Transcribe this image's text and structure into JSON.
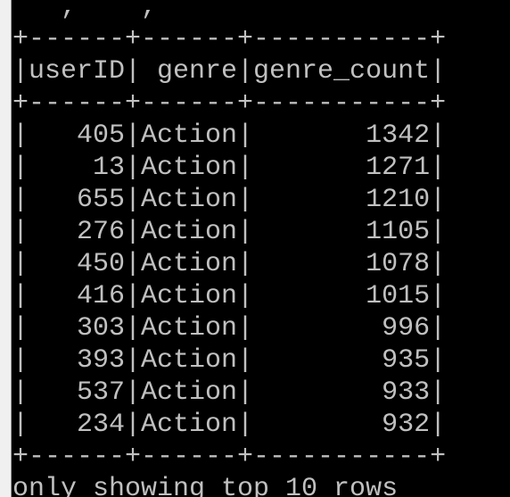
{
  "terminal": {
    "lines": [
      "+------+------+-----------+",
      "|userID| genre|genre_count|",
      "+------+------+-----------+",
      "|   405|Action|       1342|",
      "|    13|Action|       1271|",
      "|   655|Action|       1210|",
      "|   276|Action|       1105|",
      "|   450|Action|       1078|",
      "|   416|Action|       1015|",
      "|   303|Action|        996|",
      "|   393|Action|        935|",
      "|   537|Action|        933|",
      "|   234|Action|        932|",
      "+------+------+-----------+",
      "only showing top 10 rows"
    ],
    "partial_top_line": "   ,    ,",
    "colors": {
      "background": "#000000",
      "text": "#c0c0c0",
      "edge": "#f0f0f0"
    }
  }
}
